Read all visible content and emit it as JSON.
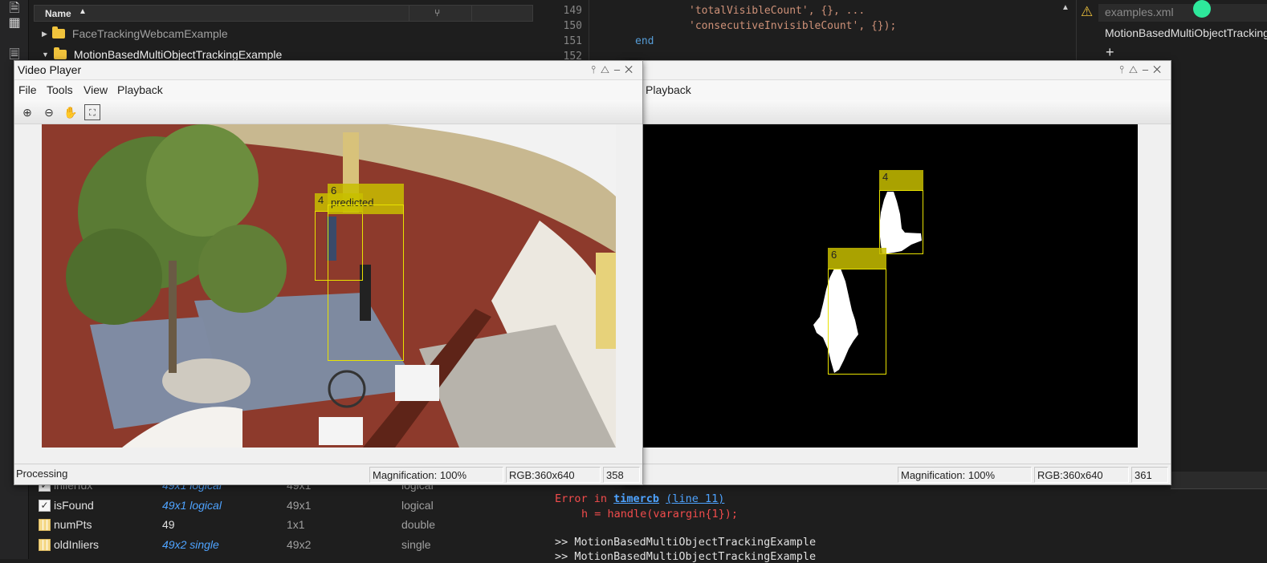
{
  "file_browser": {
    "header_name": "Name",
    "items": [
      {
        "label": "FaceTrackingWebcamExample",
        "expanded": false
      },
      {
        "label": "MotionBasedMultiObjectTrackingExample",
        "expanded": true
      }
    ]
  },
  "editor": {
    "lines": [
      {
        "num": "149",
        "code": "'totalVisibleCount', {}, ..."
      },
      {
        "num": "150",
        "code": "'consecutiveInvisibleCount', {});"
      },
      {
        "num": "151",
        "code": "end"
      },
      {
        "num": "152",
        "code": ""
      }
    ]
  },
  "right_panel": {
    "file_tab": "examples.xml",
    "example_tab": "MotionBasedMultiObjectTracking",
    "plus": "+"
  },
  "video_player_1": {
    "title": "Video Player",
    "menu": [
      "File",
      "Tools",
      "View",
      "Playback"
    ],
    "tools": [
      "zoom-in-icon",
      "zoom-out-icon",
      "pan-icon",
      "fit-to-window-icon"
    ],
    "status": {
      "text": "Processing",
      "magnification": "Magnification: 100%",
      "rgb": "RGB:360x640",
      "frame": "358"
    },
    "tracks": [
      {
        "id": "4",
        "label": "4"
      },
      {
        "id": "6",
        "label": "6"
      },
      {
        "id": "6p",
        "label": "predicted"
      }
    ]
  },
  "video_player_2": {
    "menu_visible": "Playback",
    "status": {
      "magnification": "Magnification: 100%",
      "rgb": "RGB:360x640",
      "frame": "361"
    },
    "tracks": [
      {
        "id": "4",
        "label": "4"
      },
      {
        "id": "6",
        "label": "6"
      }
    ]
  },
  "workspace": {
    "rows": [
      {
        "name": "inlierIdx",
        "value": "49x1 logical",
        "size": "49x1",
        "class": "logical",
        "icon": "check",
        "value_style": "link"
      },
      {
        "name": "isFound",
        "value": "49x1 logical",
        "size": "49x1",
        "class": "logical",
        "icon": "check",
        "value_style": "link"
      },
      {
        "name": "numPts",
        "value": "49",
        "size": "1x1",
        "class": "double",
        "icon": "grid",
        "value_style": "plain"
      },
      {
        "name": "oldInliers",
        "value": "49x2 single",
        "size": "49x2",
        "class": "single",
        "icon": "grid",
        "value_style": "link"
      }
    ]
  },
  "command_window": {
    "error_prefix": "Error in ",
    "error_func": "timercb",
    "error_line": "(line 11)",
    "error_code": "h = handle(varargin{1});",
    "prompt1": ">> MotionBasedMultiObjectTrackingExample",
    "prompt2": ">> MotionBasedMultiObjectTrackingExample"
  },
  "colors": {
    "track_label": "#c8be00",
    "track_box": "#e8e200",
    "error_text": "#f14c4c",
    "link_blue": "#4ea3ff"
  }
}
